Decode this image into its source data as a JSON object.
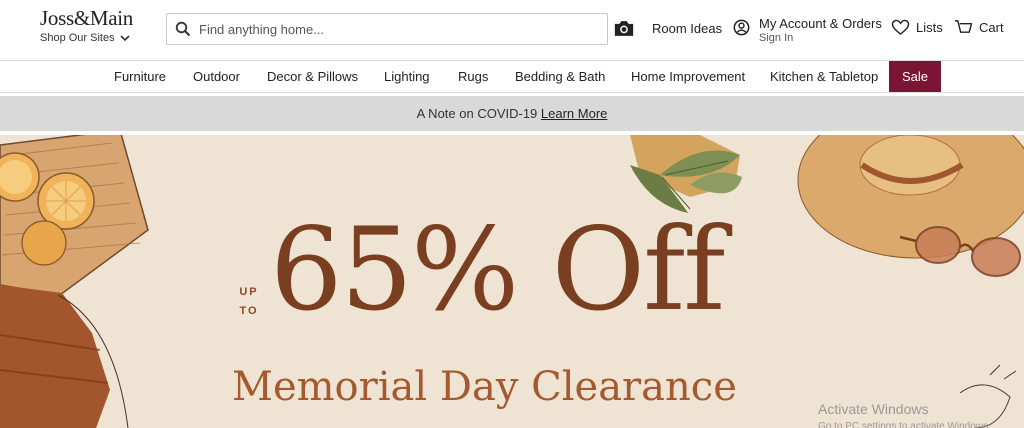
{
  "header": {
    "logo": "Joss&Main",
    "shop_sites": "Shop Our Sites",
    "search_placeholder": "Find anything home...",
    "room_ideas": "Room Ideas",
    "account_main": "My Account & Orders",
    "account_sub": "Sign In",
    "lists": "Lists",
    "cart": "Cart"
  },
  "nav": {
    "items": [
      "Furniture",
      "Outdoor",
      "Decor & Pillows",
      "Lighting",
      "Rugs",
      "Bedding & Bath",
      "Home Improvement",
      "Kitchen & Tabletop"
    ],
    "sale": "Sale",
    "sale_color": "#7b1535"
  },
  "notice": {
    "text": "A Note on COVID-19",
    "link": "Learn More"
  },
  "hero": {
    "upto_line1": "UP",
    "upto_line2": "TO",
    "headline": "65% Off",
    "subheadline": "Memorial Day Clearance",
    "headline_color": "#7a3e20",
    "background": "#efe4d3"
  },
  "watermark": {
    "title": "Activate Windows",
    "subtitle": "Go to PC settings to activate Windows."
  },
  "icons": [
    "search-icon",
    "camera-icon",
    "account-icon",
    "heart-icon",
    "cart-icon",
    "chevron-down-icon"
  ]
}
